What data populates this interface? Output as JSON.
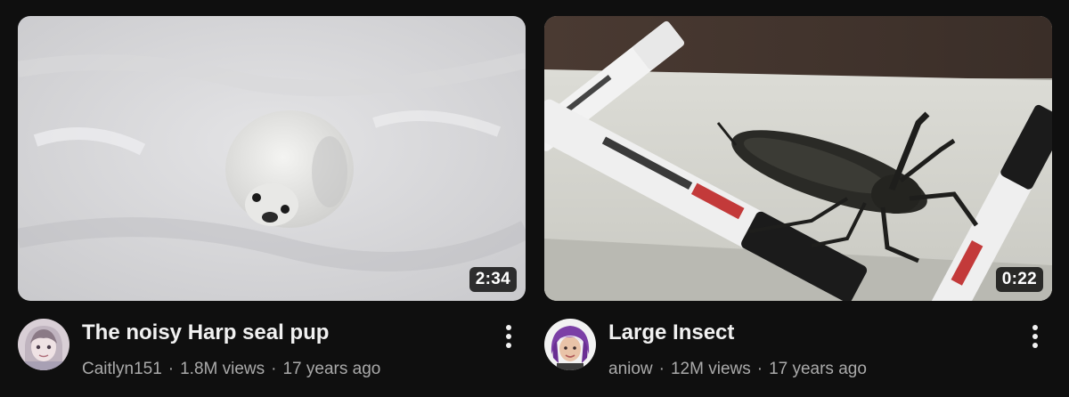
{
  "videos": [
    {
      "title": "The noisy Harp seal pup",
      "channel": "Caitlyn151",
      "views": "1.8M views",
      "age": "17 years ago",
      "duration": "2:34",
      "thumbnail_icon": "harp-seal-pup-on-snow",
      "avatar_icon": "cartoon-girl-avatar"
    },
    {
      "title": "Large Insect",
      "channel": "aniow",
      "views": "12M views",
      "age": "17 years ago",
      "duration": "0:22",
      "thumbnail_icon": "giant-water-bug-between-markers",
      "avatar_icon": "purple-hair-avatar"
    }
  ],
  "separator": "·",
  "colors": {
    "background": "#0f0f0f",
    "title": "#f1f1f1",
    "secondary": "#aaaaaa",
    "duration_bg": "#000000"
  }
}
